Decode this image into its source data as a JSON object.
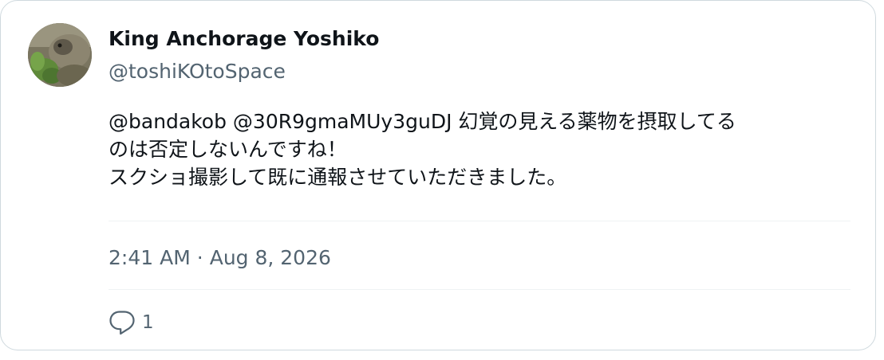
{
  "tweet": {
    "display_name": "King Anchorage Yoshiko",
    "handle": "@toshiKOtoSpace",
    "text_lines": [
      "@bandakob @30R9gmaMUy3guDJ 幻覚の見える薬物を摂取してる",
      "のは否定しないんですね！",
      "スクショ撮影して既に通報させていただきました。"
    ],
    "time": "2:41 AM",
    "separator": "·",
    "date": "Aug 8, 2026",
    "reply_count": "1"
  },
  "icons": {
    "avatar": "user-avatar-photo",
    "reply": "reply-icon"
  },
  "colors": {
    "text": "#0f1419",
    "secondary": "#536471",
    "border": "#cfd9de",
    "divider": "#eff3f4"
  }
}
